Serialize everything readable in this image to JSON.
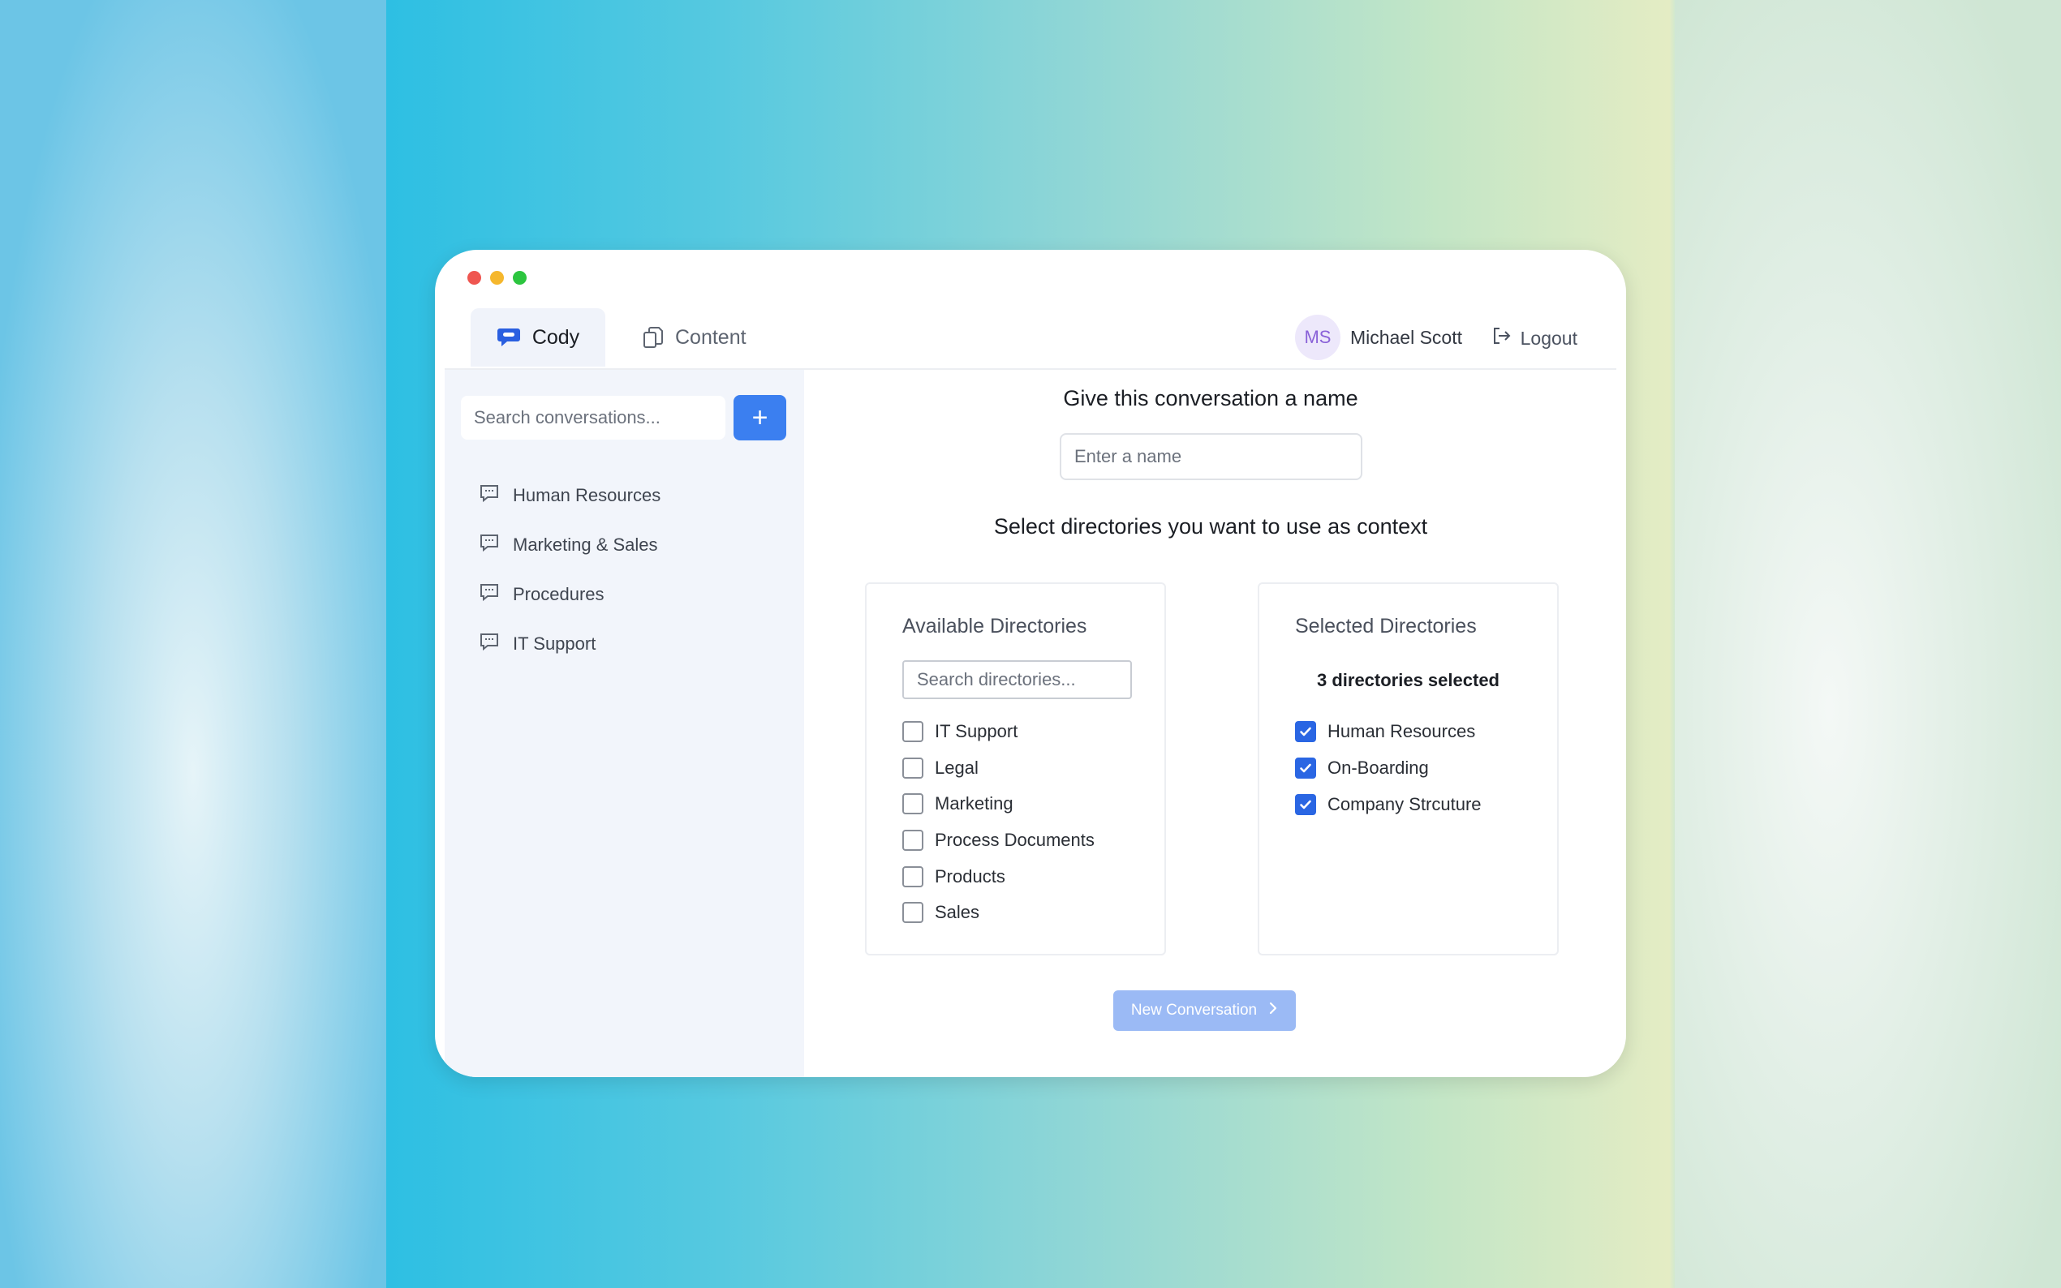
{
  "window": {
    "tabs": [
      {
        "label": "Cody",
        "icon": "chat-bubble-icon",
        "active": true
      },
      {
        "label": "Content",
        "icon": "documents-icon",
        "active": false
      }
    ],
    "user": {
      "initials": "MS",
      "name": "Michael Scott"
    },
    "logout_label": "Logout"
  },
  "sidebar": {
    "search_placeholder": "Search conversations...",
    "add_label": "+",
    "conversations": [
      {
        "label": "Human Resources"
      },
      {
        "label": "Marketing & Sales"
      },
      {
        "label": "Procedures"
      },
      {
        "label": "IT Support"
      }
    ]
  },
  "main": {
    "name_heading": "Give this conversation a name",
    "name_placeholder": "Enter a name",
    "dirs_heading": "Select directories you want to use as context",
    "available": {
      "title": "Available Directories",
      "search_placeholder": "Search directories...",
      "items": [
        {
          "label": "IT Support",
          "checked": false
        },
        {
          "label": "Legal",
          "checked": false
        },
        {
          "label": "Marketing",
          "checked": false
        },
        {
          "label": "Process Documents",
          "checked": false
        },
        {
          "label": "Products",
          "checked": false
        },
        {
          "label": "Sales",
          "checked": false
        }
      ]
    },
    "selected": {
      "title": "Selected Directories",
      "count_text": "3 directories selected",
      "items": [
        {
          "label": "Human Resources",
          "checked": true
        },
        {
          "label": "On-Boarding",
          "checked": true
        },
        {
          "label": "Company Strcuture",
          "checked": true
        }
      ]
    },
    "new_conversation_label": "New Conversation"
  },
  "colors": {
    "accent": "#3b7ff0",
    "checkbox": "#2a66e3",
    "button_disabled": "#9bbaf5"
  }
}
